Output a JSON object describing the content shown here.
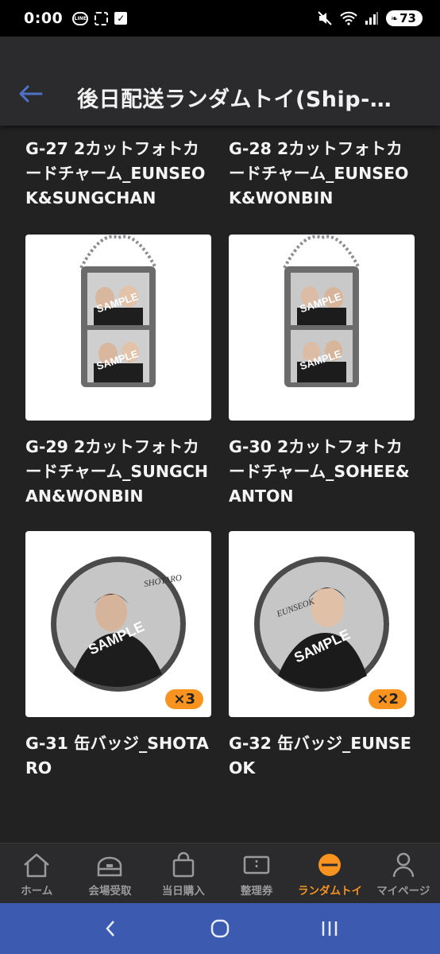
{
  "status": {
    "time": "0:00",
    "battery": "73",
    "line_label": "LINE"
  },
  "header": {
    "title": "後日配送ランダムトイ(Ship-…"
  },
  "items": [
    {
      "code": "G-27",
      "name": "G-27 2カットフォトカードチャーム_EUNSEOK&SUNGCHAN",
      "type": "none"
    },
    {
      "code": "G-28",
      "name": "G-28 2カットフォトカードチャーム_EUNSEOK&WONBIN",
      "type": "none"
    },
    {
      "code": "G-29",
      "name": "G-29 2カットフォトカードチャーム_SUNGCHAN&WONBIN",
      "type": "charm",
      "qty": ""
    },
    {
      "code": "G-30",
      "name": "G-30 2カットフォトカードチャーム_SOHEE&ANTON",
      "type": "charm",
      "qty": ""
    },
    {
      "code": "G-31",
      "name": "G-31 缶バッジ_SHOTARO",
      "type": "badge",
      "qty": "×3",
      "badge_sign": "SHOTARO"
    },
    {
      "code": "G-32",
      "name": "G-32 缶バッジ_EUNSEOK",
      "type": "badge",
      "qty": "×2",
      "badge_sign": "EUNSEOK"
    }
  ],
  "sample_text": "SAMPLE",
  "nav": [
    {
      "label": "ホーム",
      "icon": "home-icon"
    },
    {
      "label": "会場受取",
      "icon": "venue-icon"
    },
    {
      "label": "当日購入",
      "icon": "shopping-bag-icon"
    },
    {
      "label": "整理券",
      "icon": "ticket-icon"
    },
    {
      "label": "ランダムトイ",
      "icon": "random-toy-icon",
      "active": true
    },
    {
      "label": "マイページ",
      "icon": "person-icon"
    }
  ],
  "colors": {
    "accent": "#f7931e",
    "back_arrow": "#4f72c8",
    "system_nav": "#3c5bb0",
    "background": "#222222"
  }
}
